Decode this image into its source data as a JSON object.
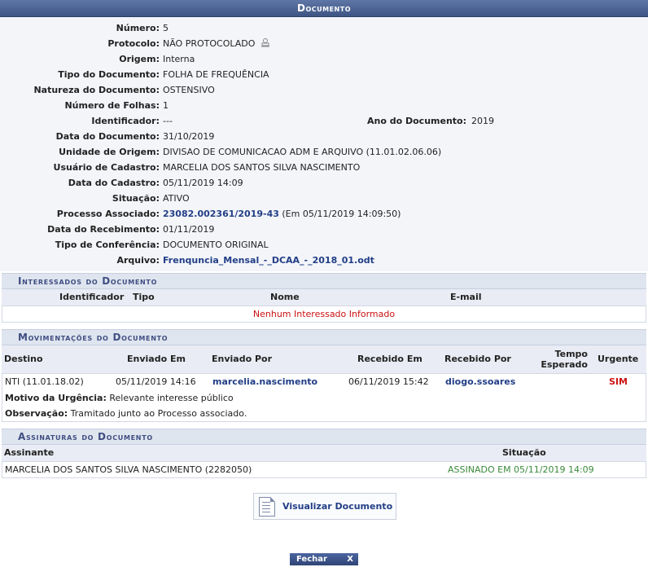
{
  "title": "Documento",
  "fields": {
    "numero": {
      "label": "Número:",
      "value": "5"
    },
    "protocolo": {
      "label": "Protocolo:",
      "value": "NÃO PROTOCOLADO"
    },
    "origem": {
      "label": "Origem:",
      "value": "Interna"
    },
    "tipo": {
      "label": "Tipo do Documento:",
      "value": "FOLHA DE FREQUÊNCIA"
    },
    "natureza": {
      "label": "Natureza do Documento:",
      "value": "OSTENSIVO"
    },
    "folhas": {
      "label": "Número de Folhas:",
      "value": "1"
    },
    "identificador": {
      "label": "Identificador:",
      "value": "---"
    },
    "ano": {
      "label": "Ano do Documento:",
      "value": "2019"
    },
    "data_doc": {
      "label": "Data do Documento:",
      "value": "31/10/2019"
    },
    "unidade": {
      "label": "Unidade de Origem:",
      "value": "DIVISAO DE COMUNICACAO ADM E ARQUIVO (11.01.02.06.06)"
    },
    "usuario": {
      "label": "Usuário de Cadastro:",
      "value": "MARCELIA DOS SANTOS SILVA NASCIMENTO"
    },
    "data_cad": {
      "label": "Data do Cadastro:",
      "value": "05/11/2019 14:09"
    },
    "situacao": {
      "label": "Situação:",
      "value": "ATIVO"
    },
    "processo": {
      "label": "Processo Associado:",
      "link": "23082.002361/2019-43",
      "suffix": "(Em 05/11/2019 14:09:50)"
    },
    "data_rec": {
      "label": "Data do Recebimento:",
      "value": "01/11/2019"
    },
    "conferencia": {
      "label": "Tipo de Conferência:",
      "value": "DOCUMENTO ORIGINAL"
    },
    "arquivo": {
      "label": "Arquivo:",
      "link": "Frenquncia_Mensal_-_DCAA_-_2018_01.odt"
    }
  },
  "interessados": {
    "title": "Interessados do Documento",
    "headers": {
      "id": "Identificador",
      "tipo": "Tipo",
      "nome": "Nome",
      "email": "E-mail"
    },
    "empty": "Nenhum Interessado Informado"
  },
  "movimentacoes": {
    "title": "Movimentações do Documento",
    "headers": {
      "destino": "Destino",
      "enviado_em": "Enviado Em",
      "enviado_por": "Enviado Por",
      "recebido_em": "Recebido Em",
      "recebido_por": "Recebido Por",
      "tempo1": "Tempo",
      "tempo2": "Esperado",
      "urgente": "Urgente"
    },
    "row": {
      "destino": "NTI (11.01.18.02)",
      "enviado_em": "05/11/2019 14:16",
      "enviado_por": "marcelia.nascimento",
      "recebido_em": "06/11/2019 15:42",
      "recebido_por": "diogo.ssoares",
      "urgente": "SIM"
    },
    "motivo_label": "Motivo da Urgência:",
    "motivo": "Relevante interesse público",
    "obs_label": "Observação:",
    "obs": "Tramitado junto ao Processo associado."
  },
  "assinaturas": {
    "title": "Assinaturas do Documento",
    "headers": {
      "assinante": "Assinante",
      "situacao": "Situação"
    },
    "row": {
      "assinante": "MARCELIA DOS SANTOS SILVA NASCIMENTO (2282050)",
      "situacao": "ASSINADO EM 05/11/2019 14:09"
    }
  },
  "buttons": {
    "visualizar": "Visualizar Documento",
    "fechar": "Fechar",
    "fechar_x": "X"
  },
  "colors": {
    "header": "#3e5484",
    "link": "#223e86",
    "red": "#cc1111",
    "green": "#3a8a3a"
  }
}
